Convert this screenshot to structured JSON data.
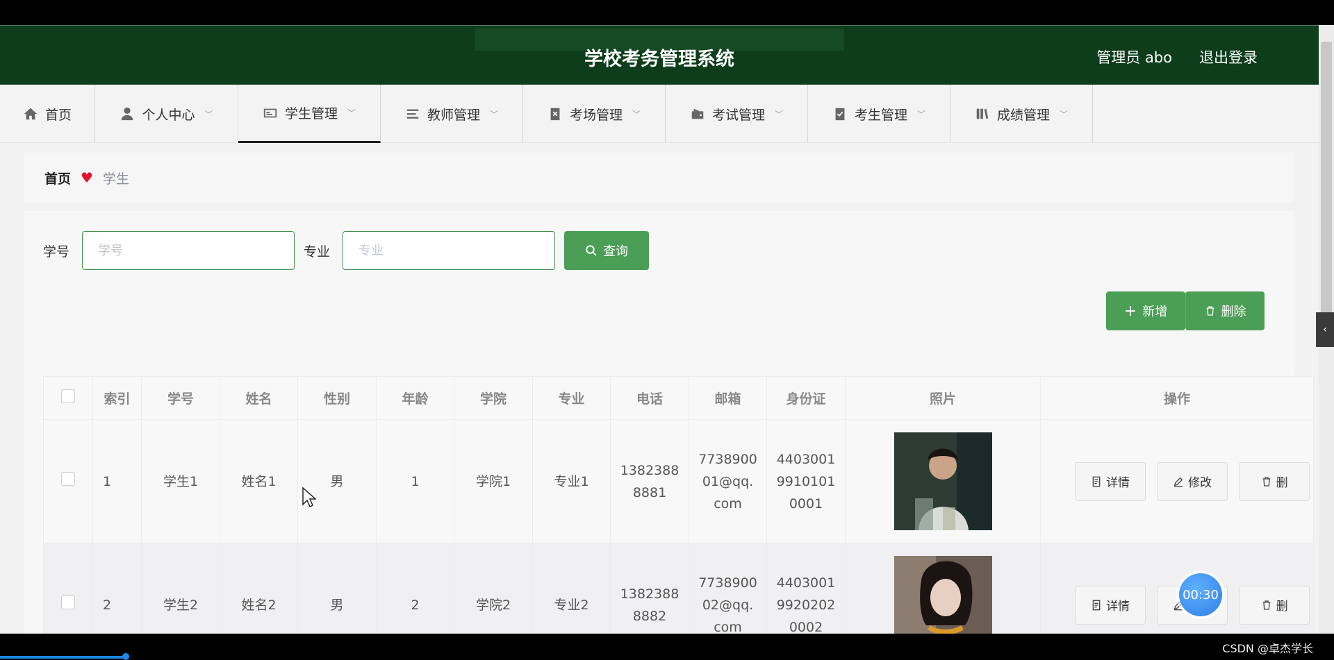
{
  "header": {
    "title": "学校考务管理系统",
    "user": "管理员 abo",
    "logout": "退出登录"
  },
  "nav": [
    {
      "label": "首页",
      "icon": "home-icon"
    },
    {
      "label": "个人中心",
      "icon": "user-icon"
    },
    {
      "label": "学生管理",
      "icon": "id-card-icon"
    },
    {
      "label": "教师管理",
      "icon": "list-icon"
    },
    {
      "label": "考场管理",
      "icon": "clipboard-x-icon"
    },
    {
      "label": "考试管理",
      "icon": "wallet-icon"
    },
    {
      "label": "考生管理",
      "icon": "clipboard-check-icon"
    },
    {
      "label": "成绩管理",
      "icon": "books-icon"
    }
  ],
  "breadcrumb": {
    "home": "首页",
    "current": "学生"
  },
  "search": {
    "id_label": "学号",
    "id_placeholder": "学号",
    "major_label": "专业",
    "major_placeholder": "专业",
    "query_button": "查询"
  },
  "actions": {
    "add": "新增",
    "delete": "删除"
  },
  "table": {
    "headers": [
      "索引",
      "学号",
      "姓名",
      "性别",
      "年龄",
      "学院",
      "专业",
      "电话",
      "邮箱",
      "身份证",
      "照片",
      "操作"
    ],
    "rows": [
      {
        "index": "1",
        "student_id": "学生1",
        "name": "姓名1",
        "gender": "男",
        "age": "1",
        "college": "学院1",
        "major": "专业1",
        "phone": [
          "1382388",
          "8881"
        ],
        "email": [
          "7738900",
          "01@qq.",
          "com"
        ],
        "id_card": [
          "4403001",
          "9910101",
          "0001"
        ]
      },
      {
        "index": "2",
        "student_id": "学生2",
        "name": "姓名2",
        "gender": "男",
        "age": "2",
        "college": "学院2",
        "major": "专业2",
        "phone": [
          "1382388",
          "8882"
        ],
        "email": [
          "7738900",
          "02@qq.",
          "com"
        ],
        "id_card": [
          "4403001",
          "9920202",
          "0002"
        ]
      }
    ],
    "op_detail": "详情",
    "op_edit": "修改",
    "op_delete": "删"
  },
  "timer": "00:30",
  "watermark": "CSDN @卓杰学长"
}
